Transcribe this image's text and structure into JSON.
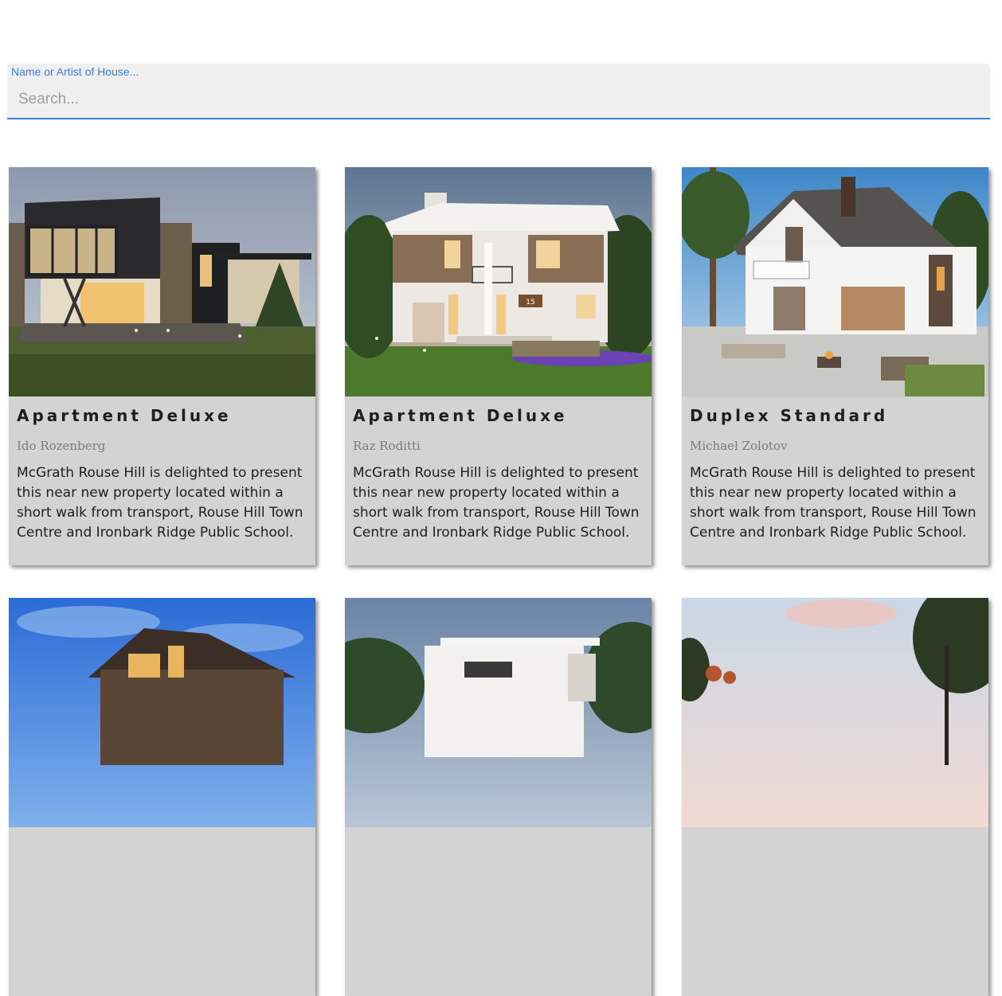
{
  "search": {
    "label": "Name or Artist of House...",
    "placeholder": "Search...",
    "value": ""
  },
  "colors": {
    "accent": "#3a7ed6",
    "card_background": "#d3d3d3",
    "search_background": "#efefef"
  },
  "cards": [
    {
      "title": "Apartment Deluxe",
      "artist": "Ido Rozenberg",
      "description": "McGrath Rouse Hill is delighted to present this near new property located within a short walk from transport, Rouse Hill Town Centre and Ironbark Ridge Public School.",
      "image": "modern-dark-house-photo"
    },
    {
      "title": "Apartment Deluxe",
      "artist": "Raz Roditti",
      "description": "McGrath Rouse Hill is delighted to present this near new property located within a short walk from transport, Rouse Hill Town Centre and Ironbark Ridge Public School.",
      "image": "white-two-story-house-photo",
      "house_number": "15"
    },
    {
      "title": "Duplex Standard",
      "artist": "Michael Zolotov",
      "description": "McGrath Rouse Hill is delighted to present this near new property located within a short walk from transport, Rouse Hill Town Centre and Ironbark Ridge Public School.",
      "image": "gabled-duplex-house-photo"
    },
    {
      "title": "",
      "artist": "",
      "description": "",
      "image": "chalet-house-dusk-photo"
    },
    {
      "title": "",
      "artist": "",
      "description": "",
      "image": "white-cube-house-photo"
    },
    {
      "title": "",
      "artist": "",
      "description": "",
      "image": "house-among-trees-photo"
    }
  ]
}
